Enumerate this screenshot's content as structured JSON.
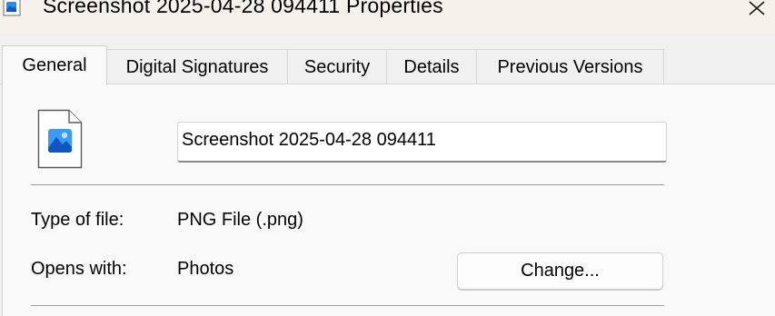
{
  "window": {
    "title": "Screenshot 2025-04-28 094411 Properties",
    "title_icon": "image-file-icon",
    "close_icon": "close-icon"
  },
  "tabs": [
    {
      "label": "General",
      "active": true
    },
    {
      "label": "Digital Signatures",
      "active": false
    },
    {
      "label": "Security",
      "active": false
    },
    {
      "label": "Details",
      "active": false
    },
    {
      "label": "Previous Versions",
      "active": false
    }
  ],
  "general": {
    "file_icon": "png-image-file-icon",
    "file_name": "Screenshot 2025-04-28 094411",
    "type_of_file_label": "Type of file:",
    "type_of_file_value": "PNG File (.png)",
    "opens_with_label": "Opens with:",
    "opens_with_value": "Photos",
    "change_button_label": "Change..."
  },
  "colors": {
    "titlebar_bg": "#f6f1ea",
    "panel_bg": "#f9f9f9",
    "icon_blue": "#1a73e8"
  }
}
